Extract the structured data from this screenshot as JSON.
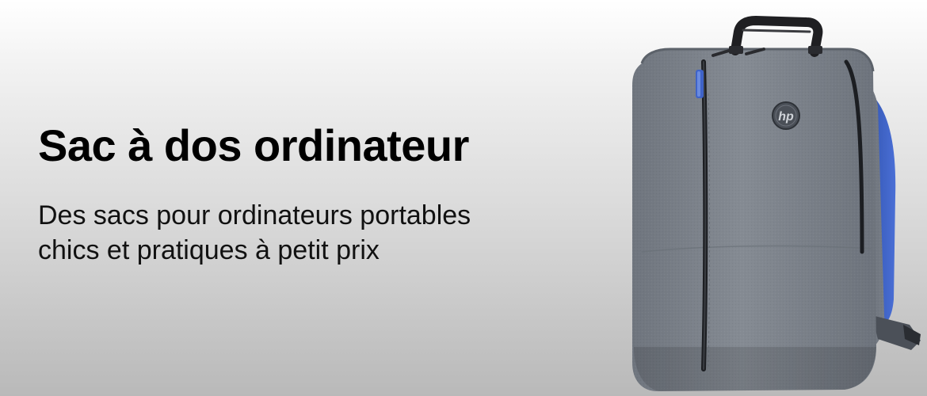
{
  "banner": {
    "headline": "Sac à dos ordinateur",
    "subline_1": "Des sacs pour ordinateurs portables",
    "subline_2": "chics et pratiques à petit prix"
  },
  "product": {
    "icon": "laptop-backpack",
    "brand_logo_icon": "hp-logo",
    "colors": {
      "body": "#7a8089",
      "strap_accent": "#3f63c8",
      "handle": "#1f1f22"
    }
  }
}
